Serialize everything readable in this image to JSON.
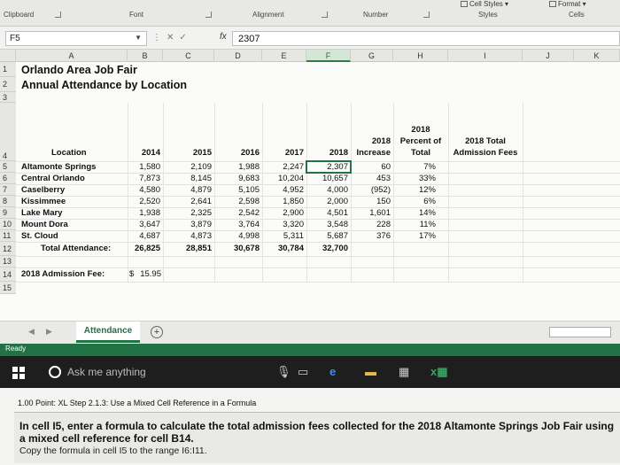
{
  "ribbon": {
    "groups": [
      "Clipboard",
      "Font",
      "Alignment",
      "Number",
      "Styles",
      "Cells"
    ],
    "cell_styles": "Cell Styles",
    "format": "Format"
  },
  "formula_bar": {
    "name_box": "F5",
    "formula_value": "2307",
    "fx_label": "fx"
  },
  "columns": [
    "A",
    "B",
    "C",
    "D",
    "E",
    "F",
    "G",
    "H",
    "I",
    "J",
    "K"
  ],
  "rows": [
    "1",
    "2",
    "3",
    "4",
    "5",
    "6",
    "7",
    "8",
    "9",
    "10",
    "11",
    "12",
    "13",
    "14",
    "15"
  ],
  "sheet": {
    "title": "Orlando Area Job Fair",
    "subtitle": "Annual Attendance by Location",
    "headers": {
      "location": "Location",
      "y2014": "2014",
      "y2015": "2015",
      "y2016": "2016",
      "y2017": "2017",
      "y2018": "2018",
      "increase_top": "2018",
      "increase_bottom": "Increase",
      "percent_top": "2018",
      "percent_mid": "Percent of",
      "percent_bottom": "Total",
      "fees_top": "2018 Total",
      "fees_bottom": "Admission Fees"
    },
    "data_rows": [
      {
        "location": "Altamonte Springs",
        "v2014": "1,580",
        "v2015": "2,109",
        "v2016": "1,988",
        "v2017": "2,247",
        "v2018": "2,307",
        "increase": "60",
        "percent": "7%"
      },
      {
        "location": "Central Orlando",
        "v2014": "7,873",
        "v2015": "8,145",
        "v2016": "9,683",
        "v2017": "10,204",
        "v2018": "10,657",
        "increase": "453",
        "percent": "33%"
      },
      {
        "location": "Caselberry",
        "v2014": "4,580",
        "v2015": "4,879",
        "v2016": "5,105",
        "v2017": "4,952",
        "v2018": "4,000",
        "increase": "(952)",
        "percent": "12%"
      },
      {
        "location": "Kissimmee",
        "v2014": "2,520",
        "v2015": "2,641",
        "v2016": "2,598",
        "v2017": "1,850",
        "v2018": "2,000",
        "increase": "150",
        "percent": "6%"
      },
      {
        "location": "Lake Mary",
        "v2014": "1,938",
        "v2015": "2,325",
        "v2016": "2,542",
        "v2017": "2,900",
        "v2018": "4,501",
        "increase": "1,601",
        "percent": "14%"
      },
      {
        "location": "Mount Dora",
        "v2014": "3,647",
        "v2015": "3,879",
        "v2016": "3,764",
        "v2017": "3,320",
        "v2018": "3,548",
        "increase": "228",
        "percent": "11%"
      },
      {
        "location": "St. Cloud",
        "v2014": "4,687",
        "v2015": "4,873",
        "v2016": "4,998",
        "v2017": "5,311",
        "v2018": "5,687",
        "increase": "376",
        "percent": "17%"
      }
    ],
    "total_row": {
      "label": "Total Attendance:",
      "v2014": "26,825",
      "v2015": "28,851",
      "v2016": "30,678",
      "v2017": "30,784",
      "v2018": "32,700"
    },
    "fee_row": {
      "label": "2018 Admission Fee:",
      "currency": "$",
      "value": "15.95"
    }
  },
  "tabs": {
    "active": "Attendance",
    "add": "+"
  },
  "status": {
    "text": "Ready"
  },
  "taskbar": {
    "search_placeholder": "Ask me anything"
  },
  "instructions": {
    "step": "1.00 Point: XL Step 2.1.3: Use a Mixed Cell Reference in a Formula",
    "question": "In cell I5, enter a formula to calculate the total admission fees collected for the 2018 Altamonte Springs Job Fair using a mixed cell reference for cell B14.",
    "copy_note": "Copy the formula in cell I5 to the range I6:I11."
  }
}
